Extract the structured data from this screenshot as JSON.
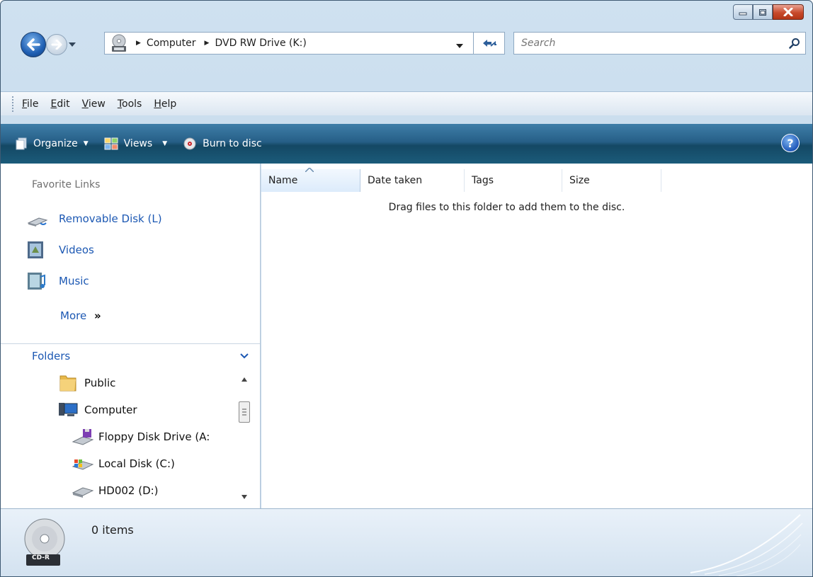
{
  "address": {
    "breadcrumbs": [
      "Computer",
      "DVD RW Drive (K:)"
    ]
  },
  "search": {
    "placeholder": "Search"
  },
  "menu": [
    {
      "label": "File",
      "key": "F",
      "rest": "ile"
    },
    {
      "label": "Edit",
      "key": "E",
      "rest": "dit"
    },
    {
      "label": "View",
      "key": "V",
      "rest": "iew"
    },
    {
      "label": "Tools",
      "key": "T",
      "rest": "ools"
    },
    {
      "label": "Help",
      "key": "H",
      "rest": "elp"
    }
  ],
  "toolbar": {
    "organize": "Organize",
    "views": "Views",
    "burn": "Burn to disc",
    "help": "?"
  },
  "nav": {
    "favorites_title": "Favorite Links",
    "favorites": [
      "Removable Disk (L)",
      "Videos",
      "Music"
    ],
    "more": "More",
    "more_glyph": "»",
    "folders_title": "Folders",
    "tree": [
      "Public",
      "Computer",
      "Floppy Disk Drive (A:",
      "Local Disk (C:)",
      "HD002 (D:)"
    ]
  },
  "columns": [
    "Name",
    "Date taken",
    "Tags",
    "Size"
  ],
  "content": {
    "empty_message": "Drag files to this folder to add them to the disc."
  },
  "status": {
    "item_count": "0 items",
    "disc_label": "CD-R"
  },
  "colors": {
    "command_bar": "#1b5b7a",
    "link_blue": "#1c58b3",
    "close_red": "#c84a2b"
  }
}
